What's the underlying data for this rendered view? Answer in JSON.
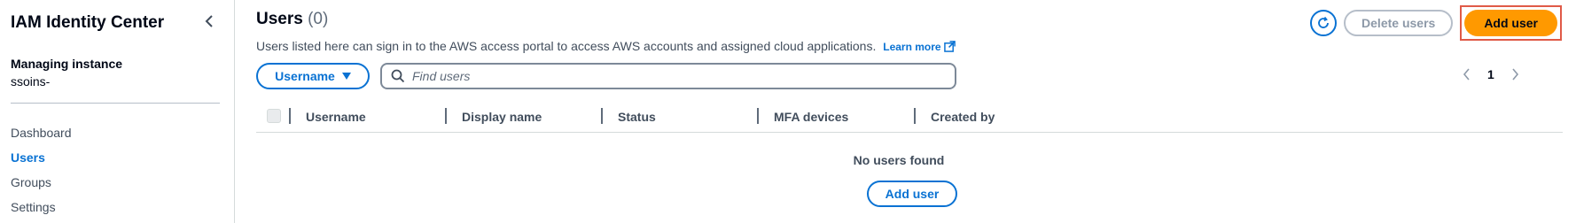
{
  "sidebar": {
    "title": "IAM Identity Center",
    "instance_label": "Managing instance",
    "instance_value": "ssoins-",
    "items": [
      {
        "label": "Dashboard",
        "active": false
      },
      {
        "label": "Users",
        "active": true
      },
      {
        "label": "Groups",
        "active": false
      },
      {
        "label": "Settings",
        "active": false
      }
    ]
  },
  "header": {
    "title": "Users",
    "count": "(0)",
    "description": "Users listed here can sign in to the AWS access portal to access AWS accounts and assigned cloud applications.",
    "learn_more": "Learn more",
    "delete_label": "Delete users",
    "add_label": "Add user"
  },
  "filter": {
    "property": "Username",
    "placeholder": "Find users"
  },
  "pagination": {
    "page": "1"
  },
  "table": {
    "columns": [
      "Username",
      "Display name",
      "Status",
      "MFA devices",
      "Created by"
    ],
    "empty_text": "No users found",
    "empty_button": "Add user"
  },
  "colors": {
    "accent": "#0972d3",
    "primary": "#ff9900",
    "highlight": "#e05a47"
  }
}
